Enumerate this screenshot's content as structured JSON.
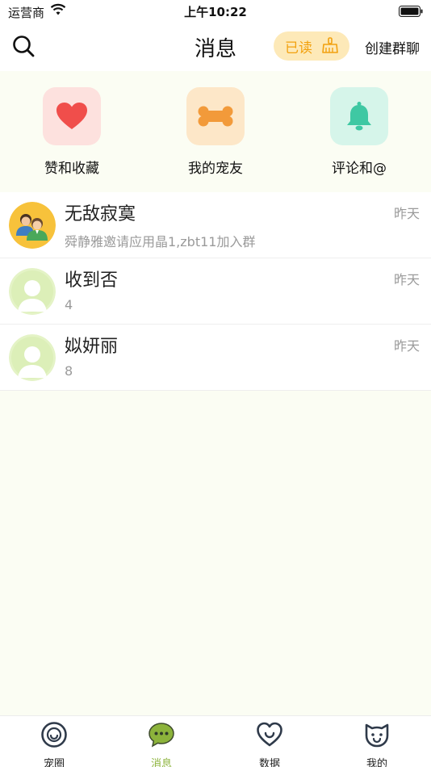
{
  "status_bar": {
    "carrier": "运营商",
    "time": "上午10:22"
  },
  "header": {
    "title": "消息",
    "read_button": "已读",
    "create_group": "创建群聊"
  },
  "quick_entries": [
    {
      "label": "赞和收藏",
      "icon": "heart-icon",
      "tile_color": "#fde1de",
      "icon_color": "#f04e4b"
    },
    {
      "label": "我的宠友",
      "icon": "bone-icon",
      "tile_color": "#fde7c8",
      "icon_color": "#f29a3a"
    },
    {
      "label": "评论和@",
      "icon": "bell-icon",
      "tile_color": "#d6f5ea",
      "icon_color": "#3fc8a3"
    }
  ],
  "conversations": [
    {
      "name": "无敌寂寞",
      "preview": "舜静雅邀请应用晶1,zbt11加入群",
      "time": "昨天",
      "avatar": "group-avatar"
    },
    {
      "name": "收到否",
      "preview": "4",
      "time": "昨天",
      "avatar": "default-avatar"
    },
    {
      "name": "姒妍丽",
      "preview": "8",
      "time": "昨天",
      "avatar": "default-avatar"
    }
  ],
  "tabbar": {
    "tabs": [
      {
        "label": "宠圈",
        "icon": "smile-circle-icon"
      },
      {
        "label": "消息",
        "icon": "chat-bubble-icon",
        "active": true
      },
      {
        "label": "数据",
        "icon": "heart-outline-icon"
      },
      {
        "label": "我的",
        "icon": "cat-face-icon"
      }
    ],
    "active_color": "#8cb33b"
  }
}
